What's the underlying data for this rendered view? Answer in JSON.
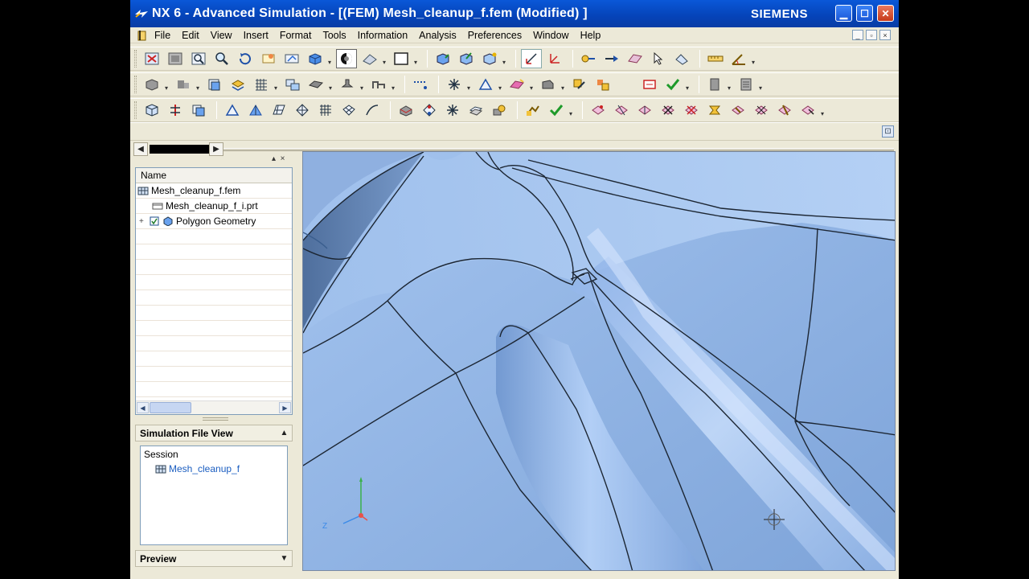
{
  "window": {
    "title": "NX 6 - Advanced Simulation - [(FEM) Mesh_cleanup_f.fem (Modified) ]",
    "brand": "SIEMENS",
    "controls": {
      "minimize": "▁",
      "maximize": "☐",
      "close": "✕"
    }
  },
  "menu": {
    "items": [
      "File",
      "Edit",
      "View",
      "Insert",
      "Format",
      "Tools",
      "Information",
      "Analysis",
      "Preferences",
      "Window",
      "Help"
    ],
    "mdi_controls": [
      "_",
      "▫",
      "×"
    ]
  },
  "toolbars": {
    "row1": [
      "fit-icon",
      "shade-icon",
      "zoom-window-icon",
      "zoom-icon",
      "rotate-icon",
      "refresh-icon",
      "snap-view-icon",
      "render-style-icon",
      "edge-display-icon",
      "background-icon",
      "display-frame-icon",
      "select-face-icon",
      "select-edge-icon",
      "select-node-icon",
      "wcs-icon",
      "csys-icon",
      "point-icon",
      "vector-icon",
      "plane-icon",
      "filter-icon",
      "measure-icon",
      "ruler-icon",
      "angle-icon"
    ],
    "row2": [
      "mesh-solid-icon",
      "mesh-mapped-icon",
      "mesh-collector-icon",
      "grid-icon",
      "mesh-controls-icon",
      "element-create-icon",
      "element-edit-icon",
      "connector-icon",
      "weld-icon",
      "node-icon",
      "spider-icon",
      "triangle-icon",
      "surface-coat-icon",
      "thickness-icon",
      "material-icon",
      "physical-icon",
      "check-icon",
      "page-icon",
      "report-icon"
    ],
    "row3": [
      "polygon-body-icon",
      "split-body-icon",
      "merge-face-icon",
      "face-split-icon",
      "cleanup-icon",
      "auto-heal-icon",
      "edge-merge-icon",
      "vertex-icon",
      "curve-icon",
      "collapse-edge-icon",
      "split-edge-icon",
      "split-face-icon",
      "match-edges-icon",
      "stitch-icon",
      "abstract-icon",
      "resolve-icon",
      "validate-icon",
      "defeature-icon",
      "hole-icon",
      "remove-icon",
      "reset-icon",
      "fillet-icon",
      "chamfer-icon",
      "partition-icon"
    ]
  },
  "navigator": {
    "column_header": "Name",
    "items": [
      {
        "label": "Mesh_cleanup_f.fem",
        "icon": "fem-file-icon",
        "indent": 0
      },
      {
        "label": "Mesh_cleanup_f_i.prt",
        "icon": "part-file-icon",
        "indent": 1
      },
      {
        "label": "Polygon Geometry",
        "icon": "polygon-geometry-icon",
        "indent": 1,
        "checked": true,
        "expandable": true
      }
    ]
  },
  "simulation_file_view": {
    "title": "Simulation File View",
    "session_label": "Session",
    "item": "Mesh_cleanup_f"
  },
  "preview": {
    "title": "Preview"
  },
  "triad": {
    "z_label": "Z",
    "x_color": "#e8524a",
    "y_color": "#3ab04a",
    "z_color": "#3a8ae8"
  },
  "colors": {
    "titlebar": "#0543b8",
    "model_surface": "#8fb3e6",
    "model_edge": "#1c2633"
  }
}
